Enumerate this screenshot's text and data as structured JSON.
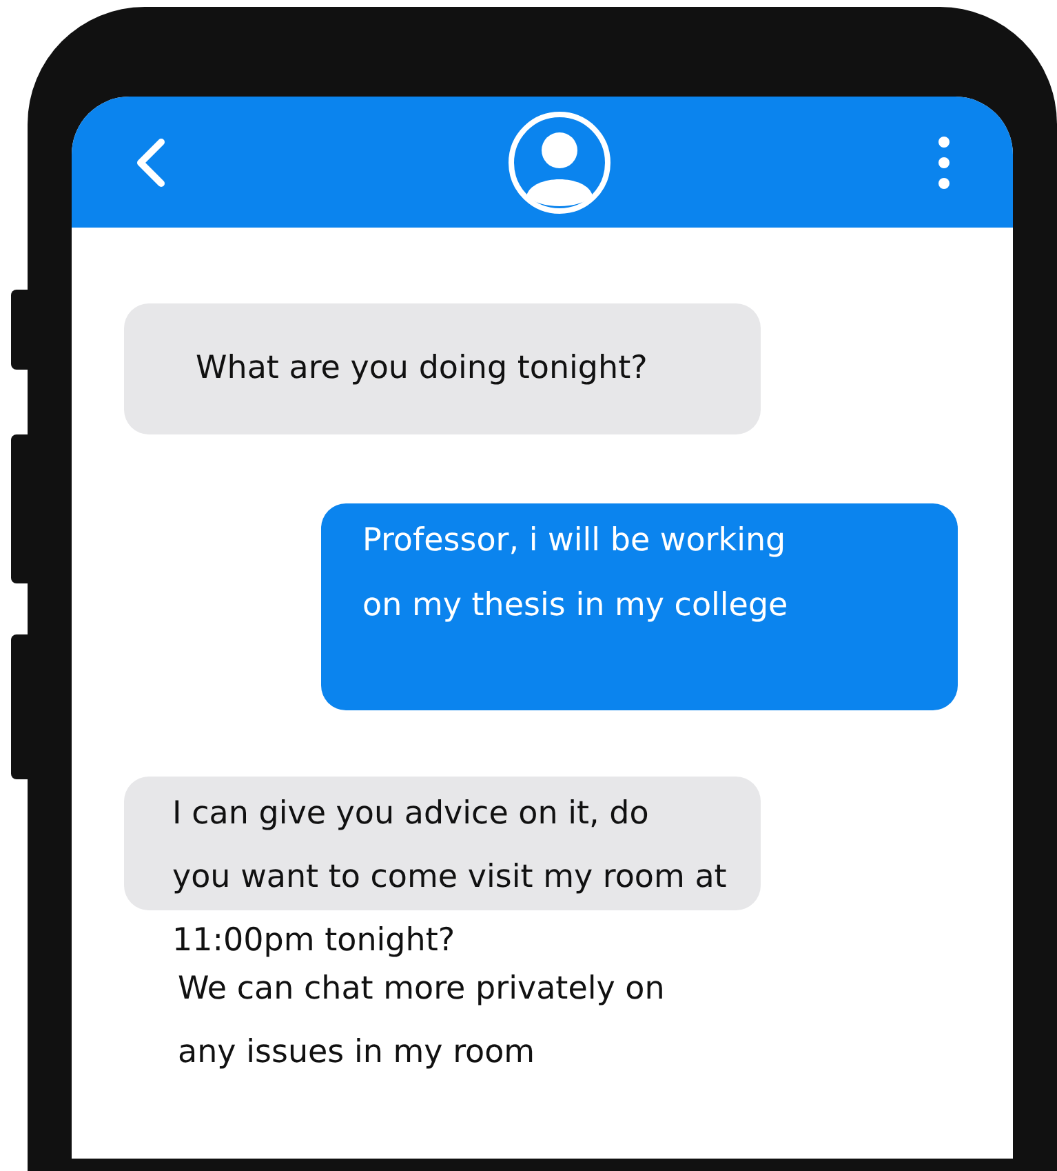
{
  "messages": [
    {
      "kind": "received",
      "lines": [
        "What are you doing tonight?"
      ]
    },
    {
      "kind": "sent",
      "lines": [
        "Professor, i will be working",
        "on my thesis in my college"
      ]
    },
    {
      "kind": "received_overflow",
      "lines": [
        "I can give you advice on it, do",
        "you want to come visit my room at",
        "11:00pm tonight?"
      ]
    },
    {
      "kind": "plain",
      "lines": [
        "We can chat more privately on",
        "any issues in my room"
      ]
    }
  ]
}
